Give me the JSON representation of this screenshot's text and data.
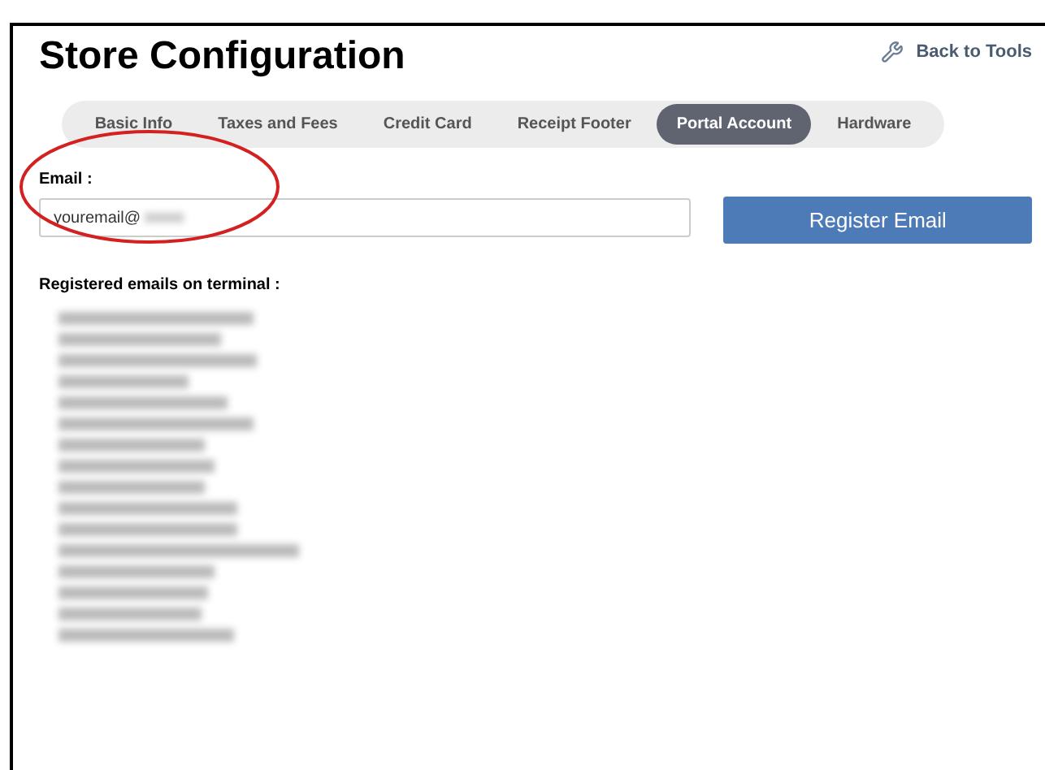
{
  "page": {
    "title": "Store Configuration",
    "back_link": "Back to Tools"
  },
  "tabs": [
    {
      "label": "Basic Info",
      "selected": false
    },
    {
      "label": "Taxes and Fees",
      "selected": false
    },
    {
      "label": "Credit Card",
      "selected": false
    },
    {
      "label": "Receipt Footer",
      "selected": false
    },
    {
      "label": "Portal Account",
      "selected": true
    },
    {
      "label": "Hardware",
      "selected": false
    }
  ],
  "email_form": {
    "label": "Email :",
    "value": "youremail@",
    "button": "Register Email"
  },
  "registered": {
    "heading": "Registered emails on terminal :"
  }
}
